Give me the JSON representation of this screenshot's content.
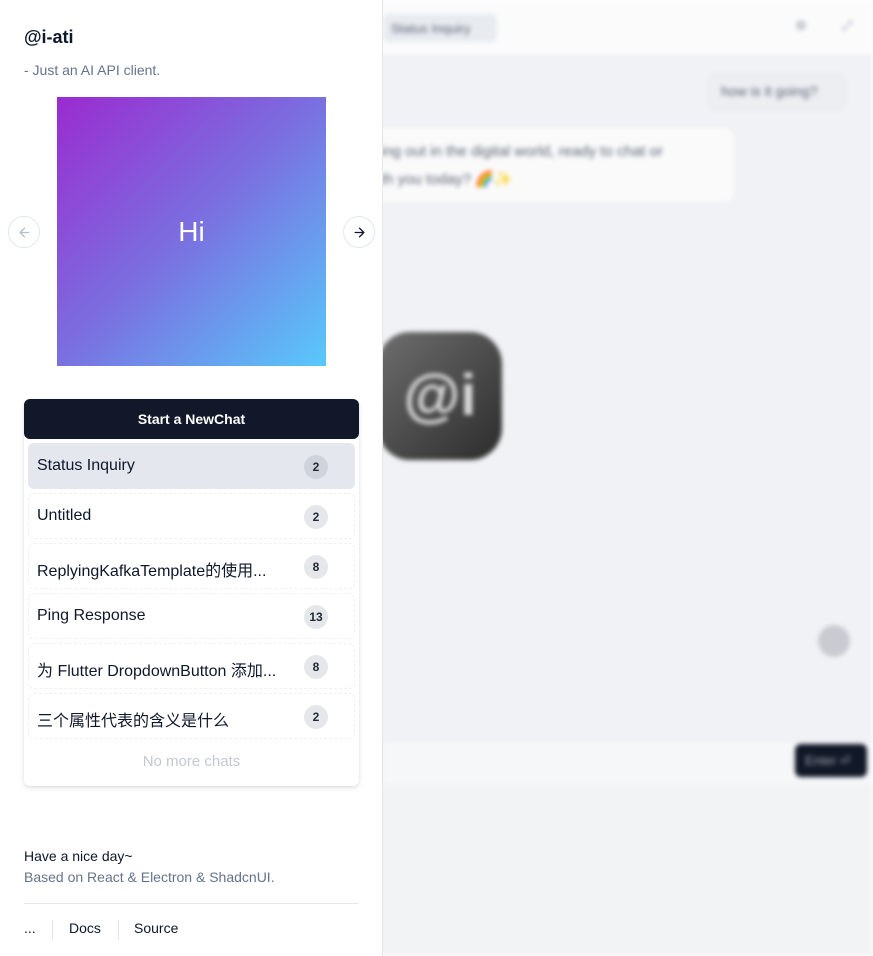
{
  "background": {
    "tab_label": "Status Inquiry",
    "user_message": "how is it going?",
    "bot_message_line1": "ing out in the digital world, ready to chat or",
    "bot_message_line2": "th you today? 🌈✨",
    "logo_text": "@i",
    "enter_label": "Enter ⏎"
  },
  "sidebar": {
    "title": "@i-ati",
    "subtitle": "- Just an AI API client.",
    "carousel": {
      "slide_text": "Hi"
    },
    "new_chat_label": "Start a NewChat",
    "chats": [
      {
        "name": "Status Inquiry",
        "count": "2"
      },
      {
        "name": "Untitled",
        "count": "2"
      },
      {
        "name": "ReplyingKafkaTemplate的使用...",
        "count": "8"
      },
      {
        "name": "Ping Response",
        "count": "13"
      },
      {
        "name": "为 Flutter DropdownButton 添加...",
        "count": "8"
      },
      {
        "name": "三个属性代表的含义是什么",
        "count": "2"
      }
    ],
    "no_more_label": "No more chats",
    "footer": {
      "title": "Have a nice day~",
      "subtitle": "Based on React & Electron & ShadcnUI.",
      "links": [
        "...",
        "Docs",
        "Source"
      ]
    }
  }
}
